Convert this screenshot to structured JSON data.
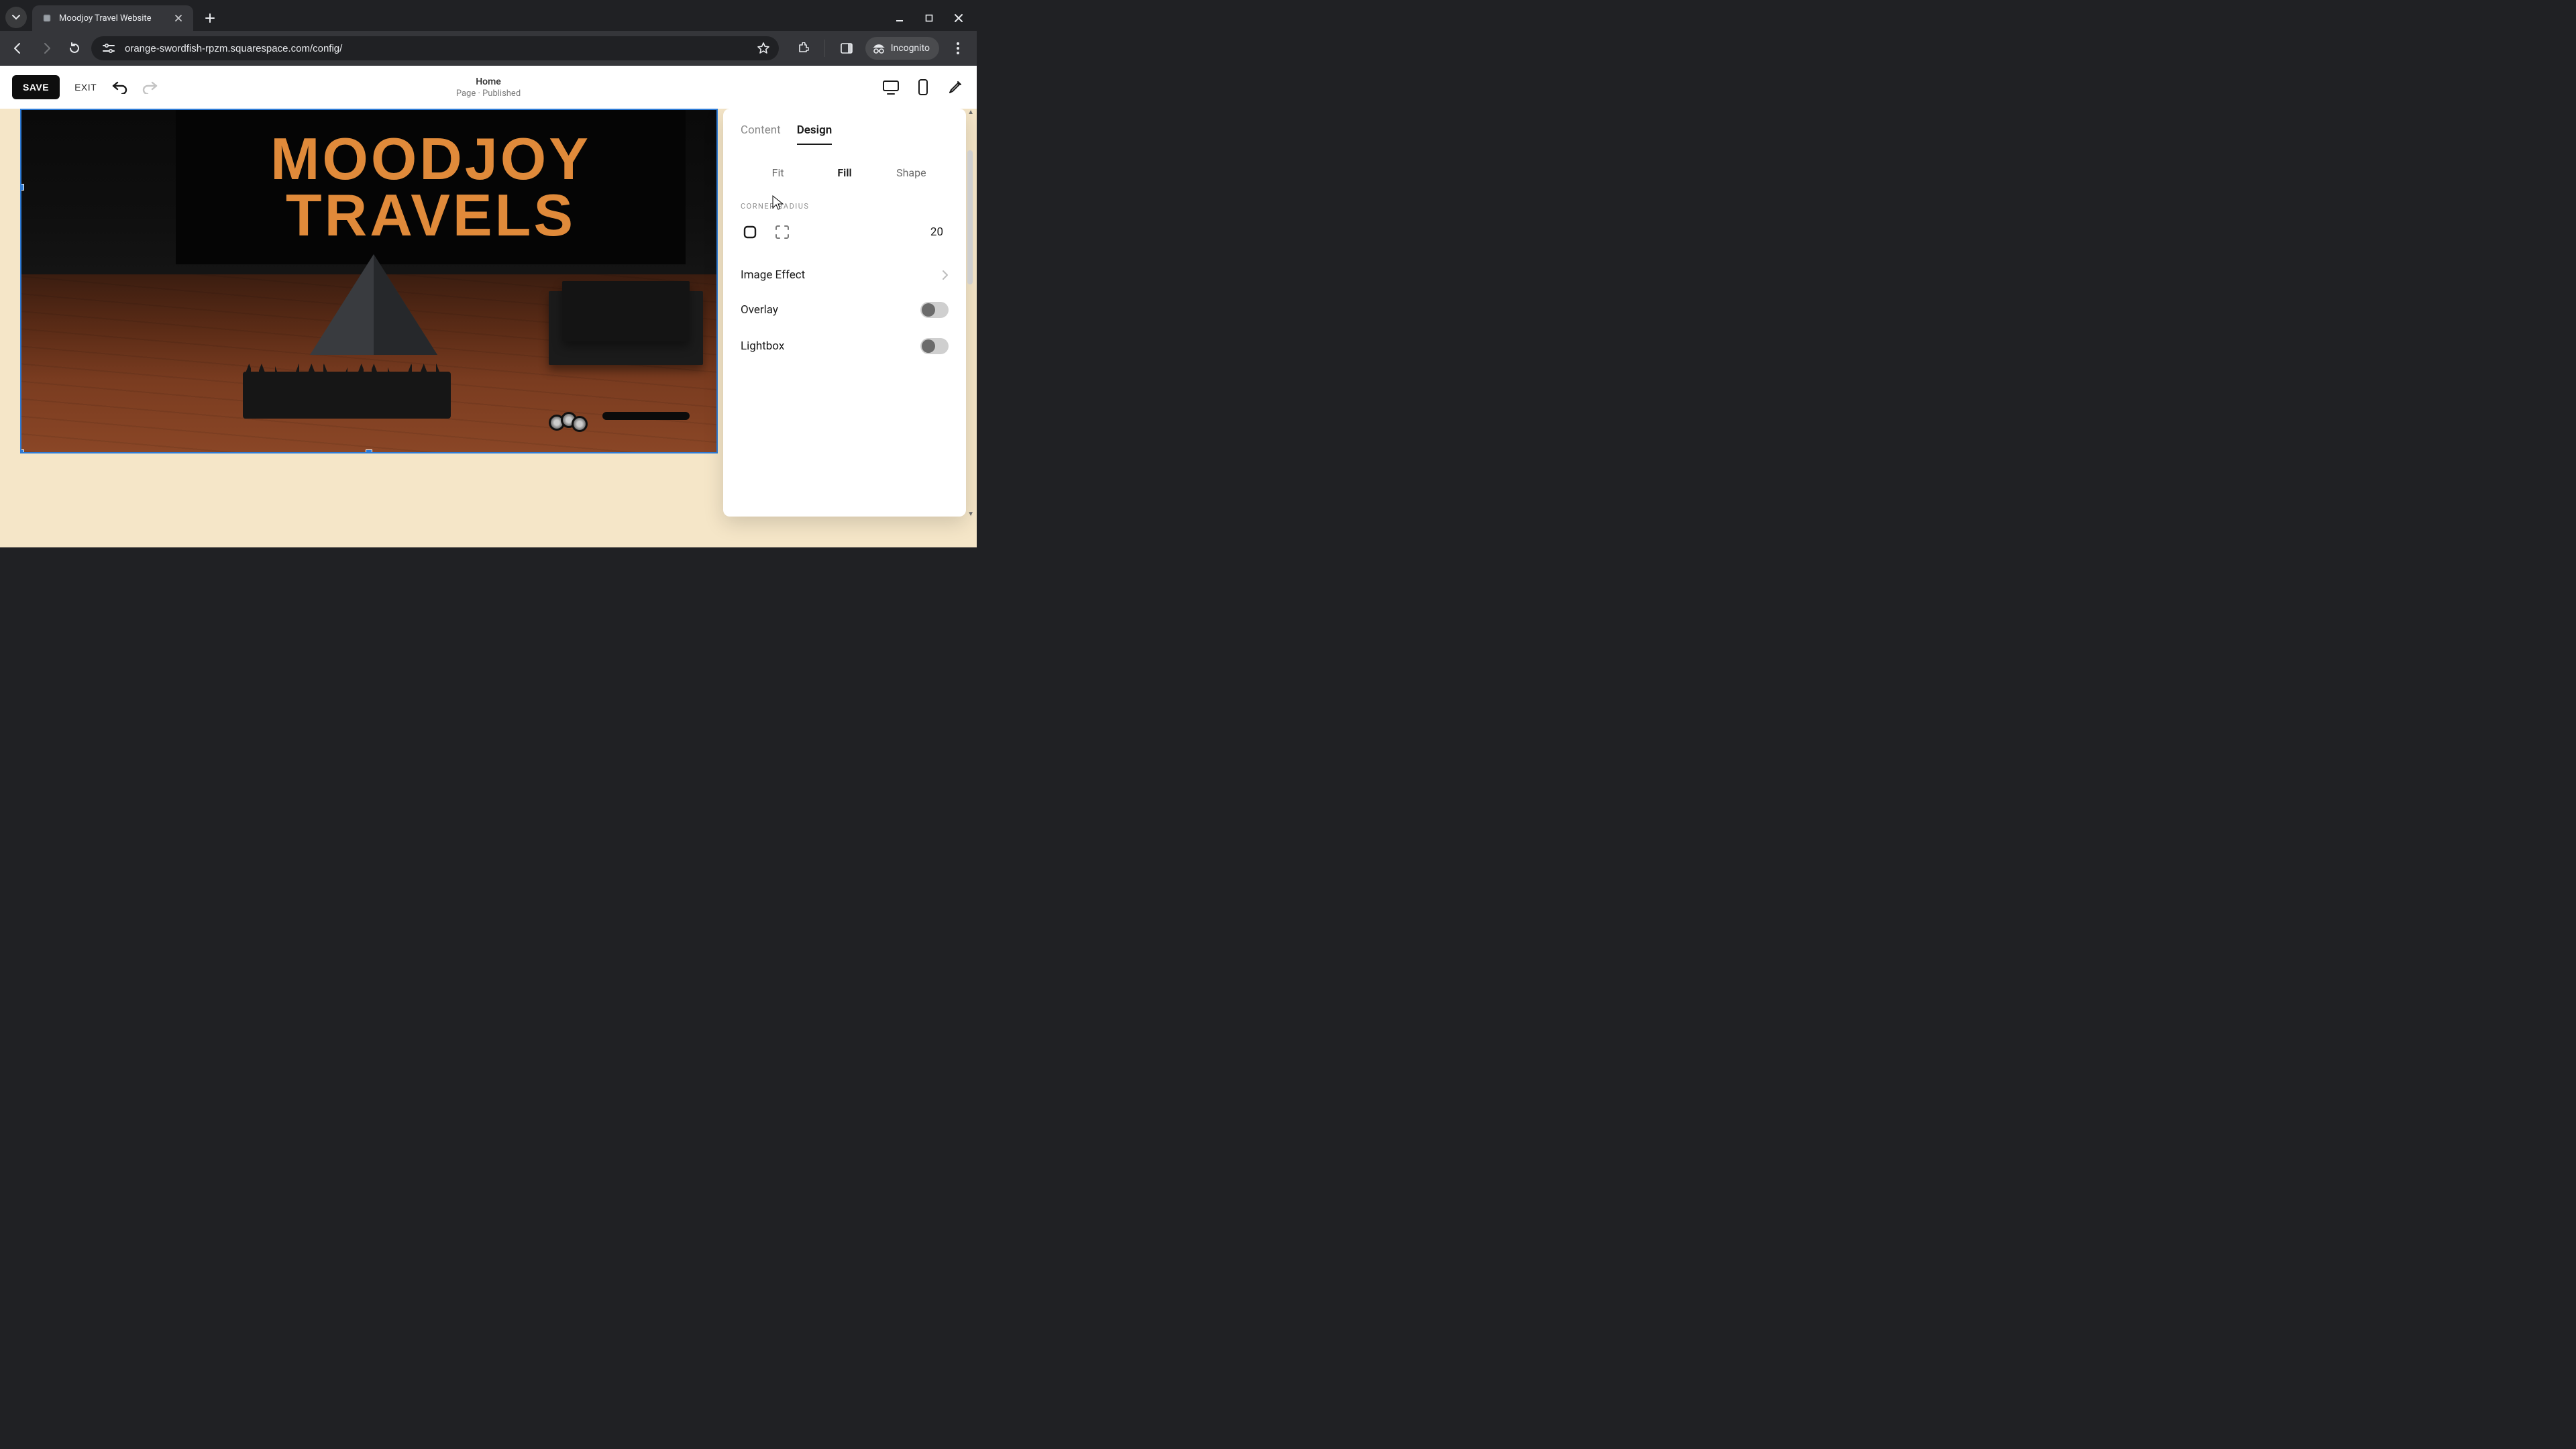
{
  "browser": {
    "tab_title": "Moodjoy Travel Website",
    "url": "orange-swordfish-rpzm.squarespace.com/config/",
    "incognito_label": "Incognito"
  },
  "app_topbar": {
    "save_label": "SAVE",
    "exit_label": "EXIT",
    "page_name": "Home",
    "page_status": "Page · Published"
  },
  "canvas": {
    "title_line1": "MOODJOY",
    "title_line2": "TRAVELS"
  },
  "panel": {
    "tabs": {
      "content": "Content",
      "design": "Design",
      "active": "design"
    },
    "fit_modes": {
      "fit": "Fit",
      "fill": "Fill",
      "shape": "Shape",
      "selected": "fill"
    },
    "corner_radius_label": "CORNER RADIUS",
    "corner_radius_value": "20",
    "image_effect_label": "Image Effect",
    "overlay_label": "Overlay",
    "overlay_on": false,
    "lightbox_label": "Lightbox",
    "lightbox_on": false
  }
}
